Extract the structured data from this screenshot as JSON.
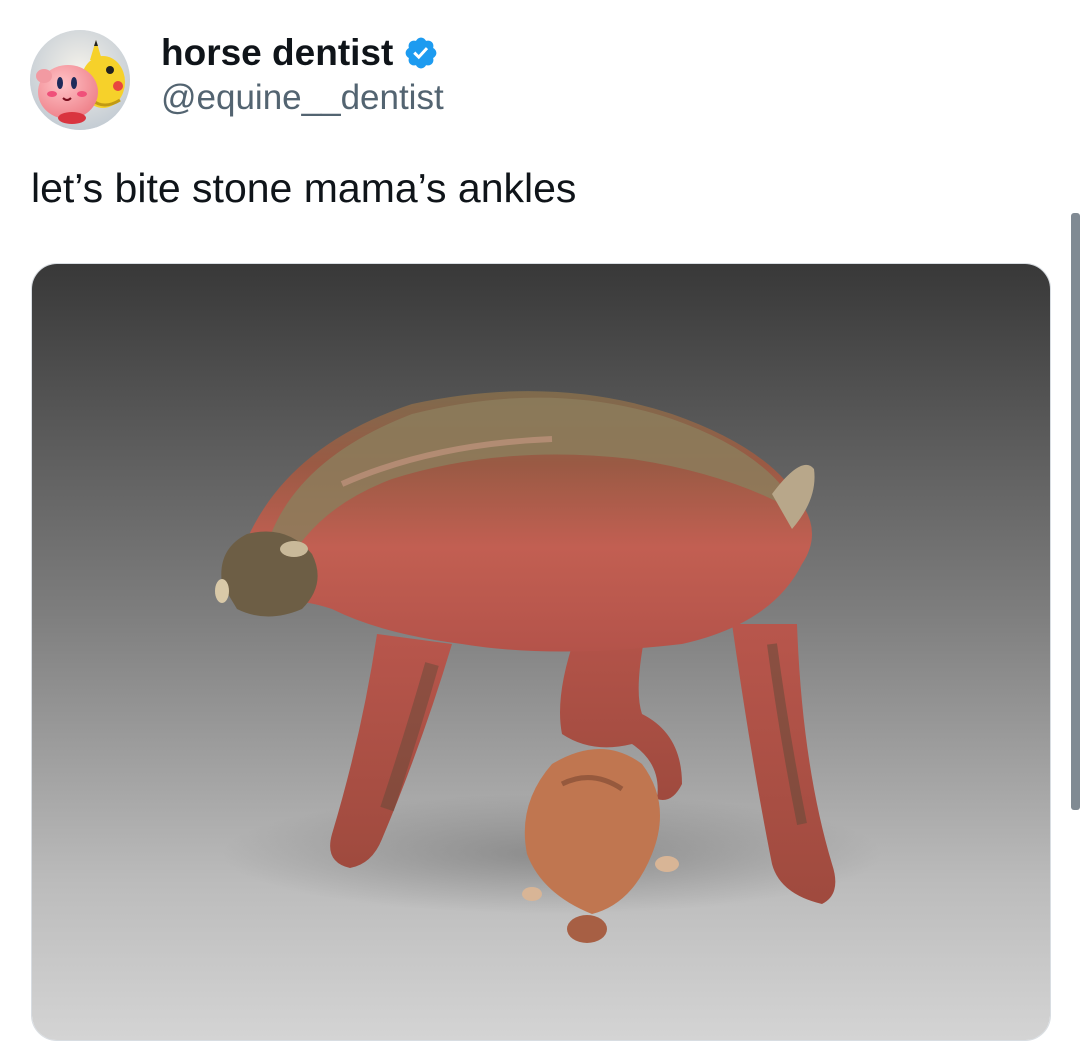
{
  "post": {
    "display_name": "horse dentist",
    "handle": "@equine__dentist",
    "verified_badge": "verified-badge-icon",
    "text": "let’s bite stone mama’s ankles"
  },
  "avatar": {
    "description_icons": [
      "kirby-icon",
      "pikachu-icon"
    ]
  },
  "media": {
    "type": "photo",
    "subject_icon": "ceramic-creature-sculpture-image"
  },
  "colors": {
    "text_primary": "#0f1419",
    "text_secondary": "#536471",
    "verified_blue": "#1d9bf0",
    "clay_red": "#b5584a",
    "glaze_brown": "#8a7a5a",
    "background_gray": "#6d6d6d"
  }
}
